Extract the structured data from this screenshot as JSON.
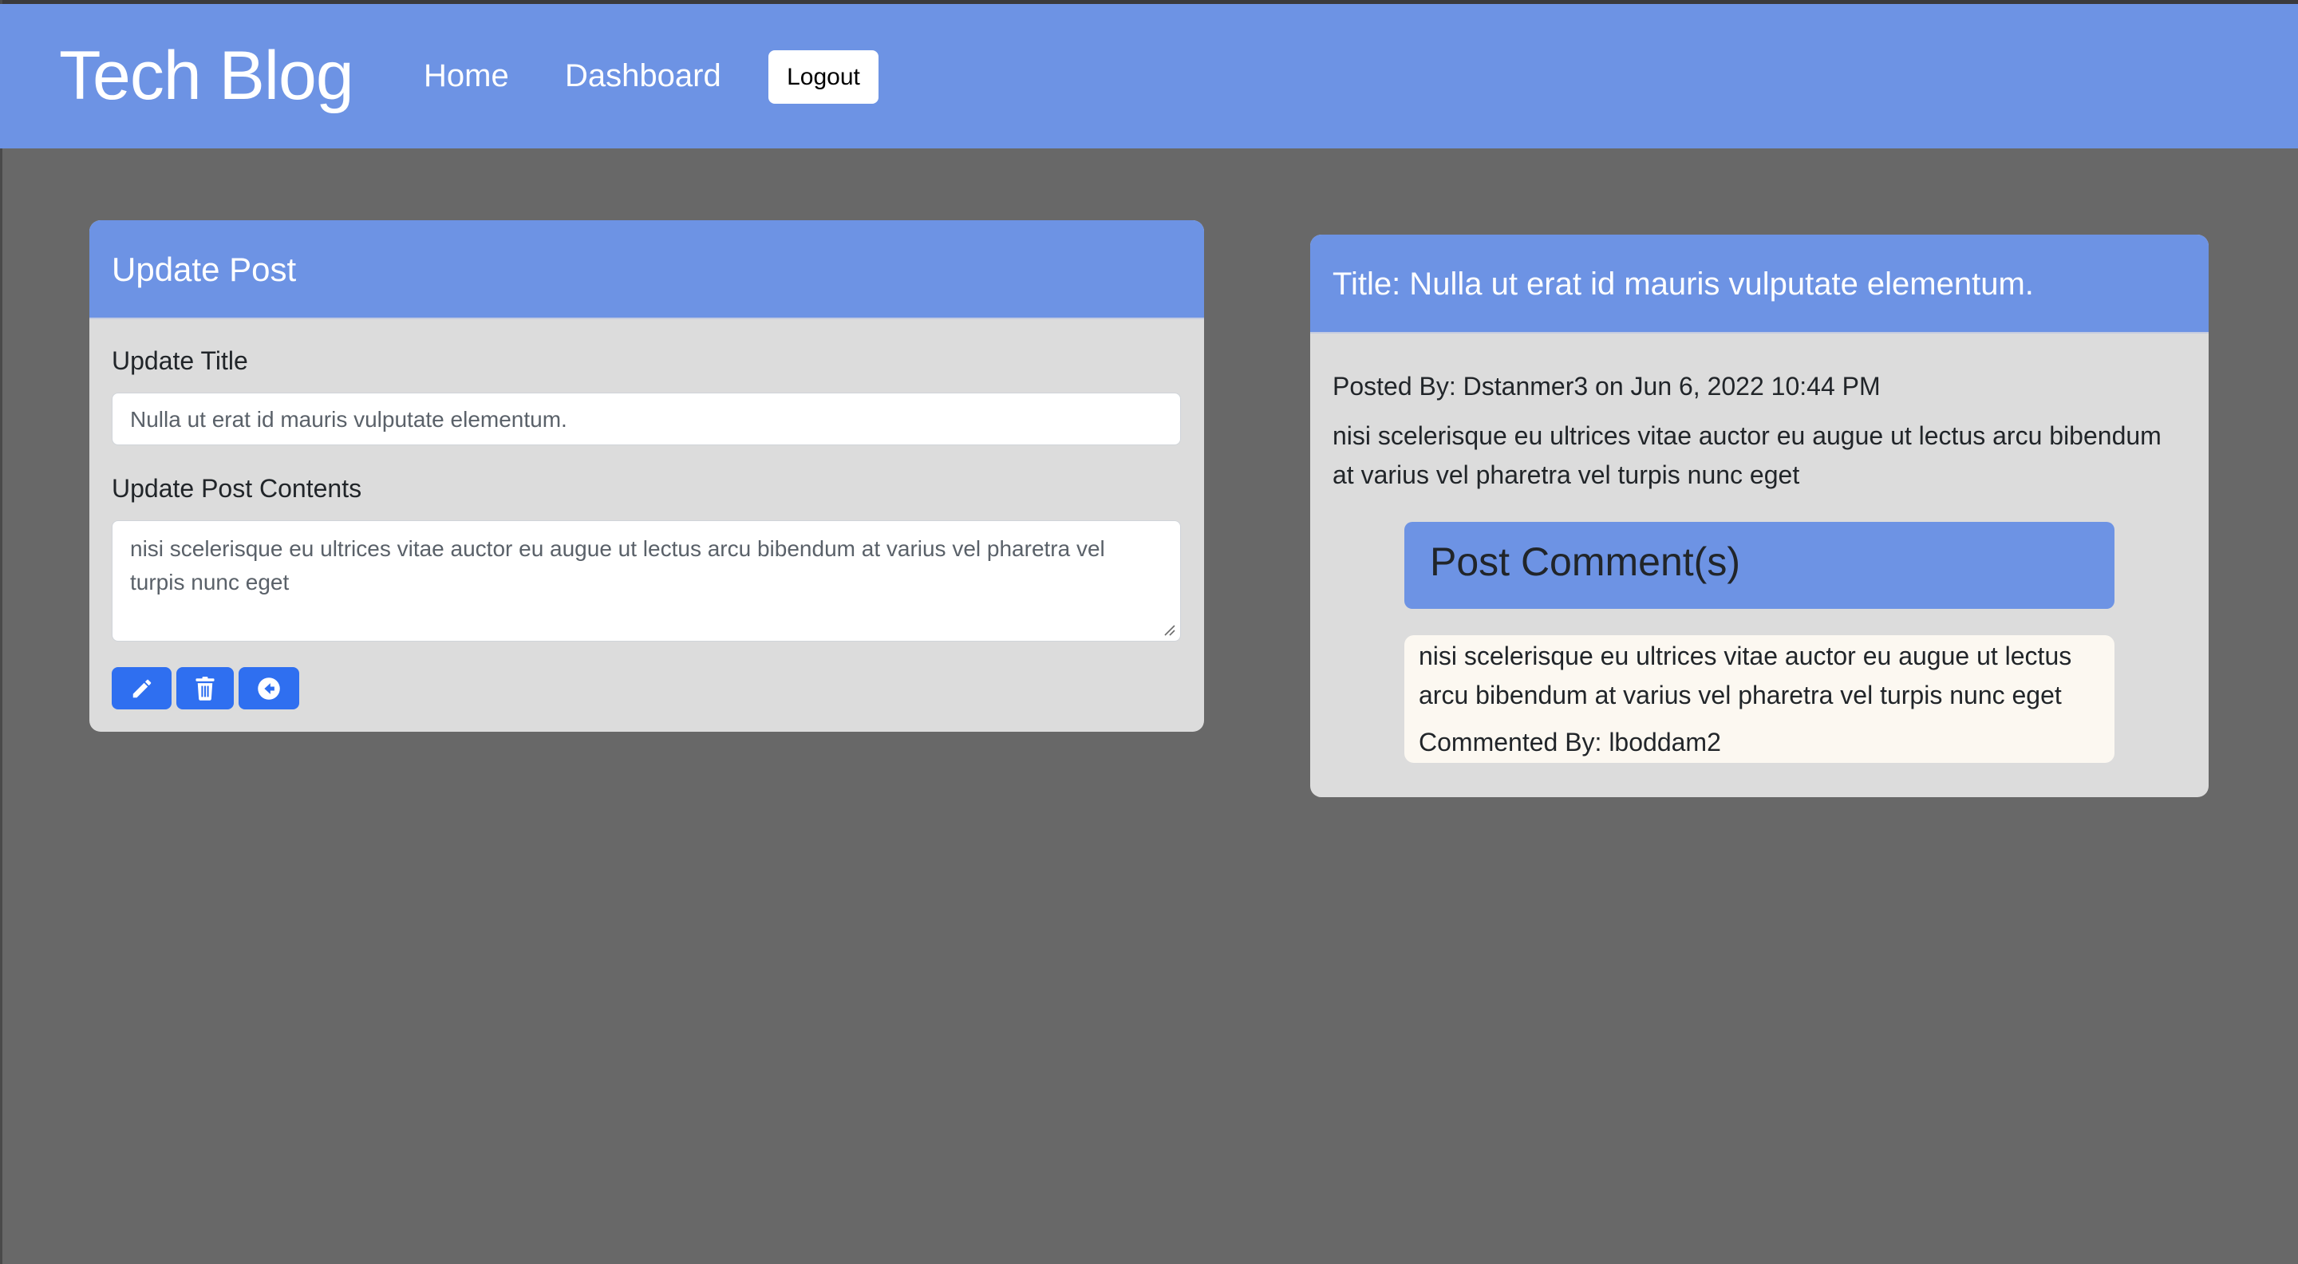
{
  "header": {
    "brand": "Tech Blog",
    "nav": {
      "home": "Home",
      "dashboard": "Dashboard",
      "logout": "Logout"
    },
    "color": "#6d93e4"
  },
  "update_form": {
    "heading": "Update Post",
    "title_label": "Update Title",
    "title_value": "Nulla ut erat id mauris vulputate elementum.",
    "contents_label": "Update Post Contents",
    "contents_value": "nisi scelerisque eu ultrices vitae auctor eu augue ut lectus arcu bibendum at varius vel pharetra vel turpis nunc eget",
    "buttons": [
      {
        "icon": "pencil-icon"
      },
      {
        "icon": "trash-icon"
      },
      {
        "icon": "arrow-left-circle-icon"
      }
    ],
    "button_color": "#2f6ff0"
  },
  "post": {
    "title": "Title: Nulla ut erat id mauris vulputate elementum.",
    "posted_by": "Posted By: Dstanmer3 on Jun 6, 2022 10:44 PM",
    "body": "nisi scelerisque eu ultrices vitae auctor eu augue ut lectus arcu bibendum at varius vel pharetra vel turpis nunc eget",
    "comments_heading": "Post Comment(s)",
    "comments": [
      {
        "text": "nisi scelerisque eu ultrices vitae auctor eu augue ut lectus arcu bibendum at varius vel pharetra vel turpis nunc eget",
        "author": "Commented By: lboddam2"
      }
    ]
  },
  "colors": {
    "page_background": "#686868",
    "card_background": "#dcdcdc",
    "comment_background": "#fcf8f1"
  }
}
